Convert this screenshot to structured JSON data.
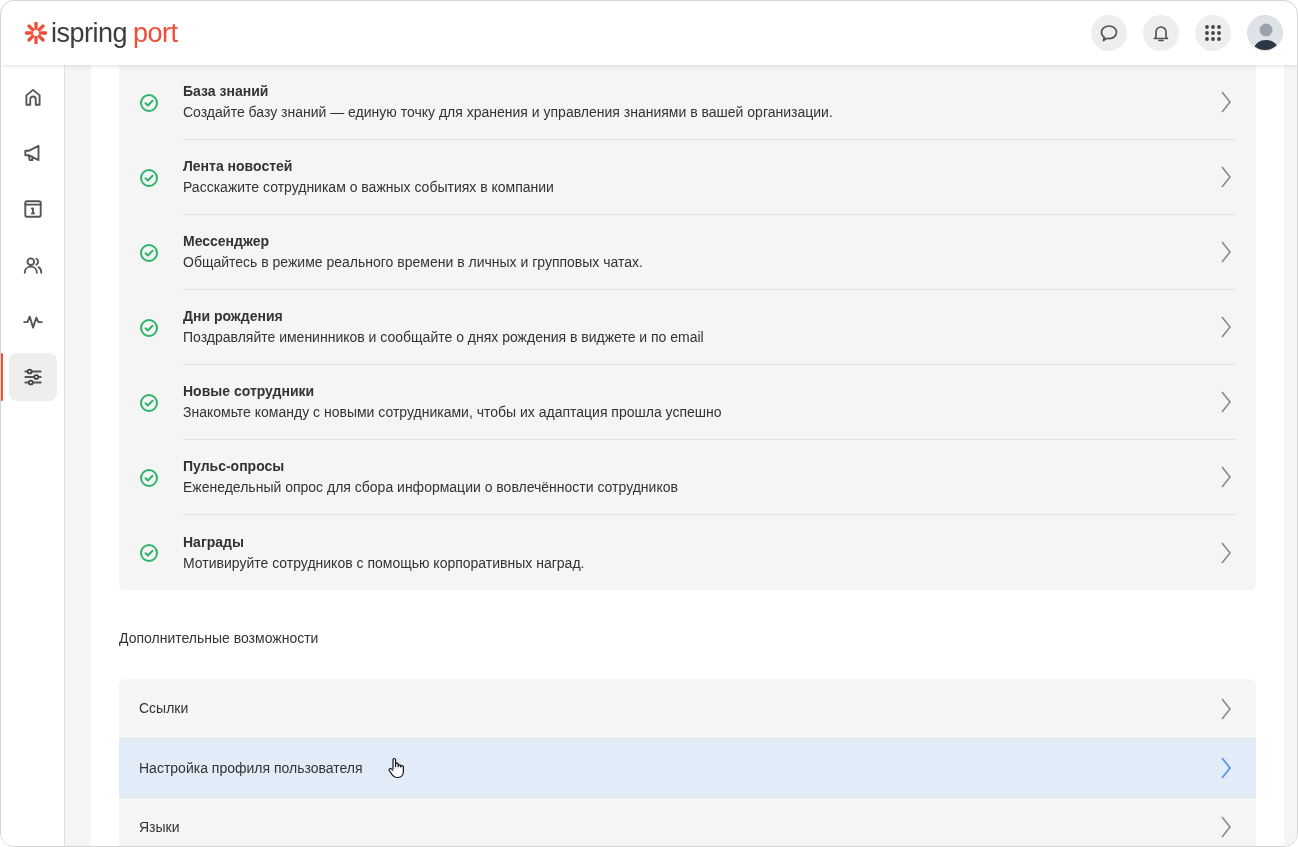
{
  "header": {
    "logo": {
      "word": "ispring",
      "accent": "port"
    },
    "actions": [
      {
        "kind": "chat"
      },
      {
        "kind": "bell"
      },
      {
        "kind": "apps"
      },
      {
        "kind": "avatar"
      }
    ]
  },
  "sidebar": {
    "items": [
      {
        "kind": "home",
        "selected": false
      },
      {
        "kind": "megaphone",
        "selected": false
      },
      {
        "kind": "info",
        "selected": false
      },
      {
        "kind": "people",
        "selected": false
      },
      {
        "kind": "pulse",
        "selected": false
      },
      {
        "kind": "sliders",
        "selected": true
      }
    ]
  },
  "features": [
    {
      "title": "База знаний",
      "description": "Создайте базу знаний — единую точку для хранения и управления знаниями в вашей организации.",
      "enabled": true
    },
    {
      "title": "Лента новостей",
      "description": "Расскажите сотрудникам о важных событиях в компании",
      "enabled": true
    },
    {
      "title": "Мессенджер",
      "description": "Общайтесь в режиме реального времени в личных и групповых чатах.",
      "enabled": true
    },
    {
      "title": "Дни рождения",
      "description": "Поздравляйте именинников и сообщайте о днях рождения в виджете и по email",
      "enabled": true
    },
    {
      "title": "Новые сотрудники",
      "description": "Знакомьте команду с новыми сотрудниками, чтобы их адаптация прошла успешно",
      "enabled": true
    },
    {
      "title": "Пульс-опросы",
      "description": "Еженедельный опрос для сбора информации о вовлечённости сотрудников",
      "enabled": true
    },
    {
      "title": "Награды",
      "description": "Мотивируйте сотрудников с помощью корпоративных наград.",
      "enabled": true
    }
  ],
  "extra_section": {
    "heading": "Дополнительные возможности",
    "items": [
      {
        "label": "Ссылки",
        "hovered": false
      },
      {
        "label": "Настройка профиля пользователя",
        "hovered": true
      },
      {
        "label": "Языки",
        "hovered": false
      }
    ]
  }
}
